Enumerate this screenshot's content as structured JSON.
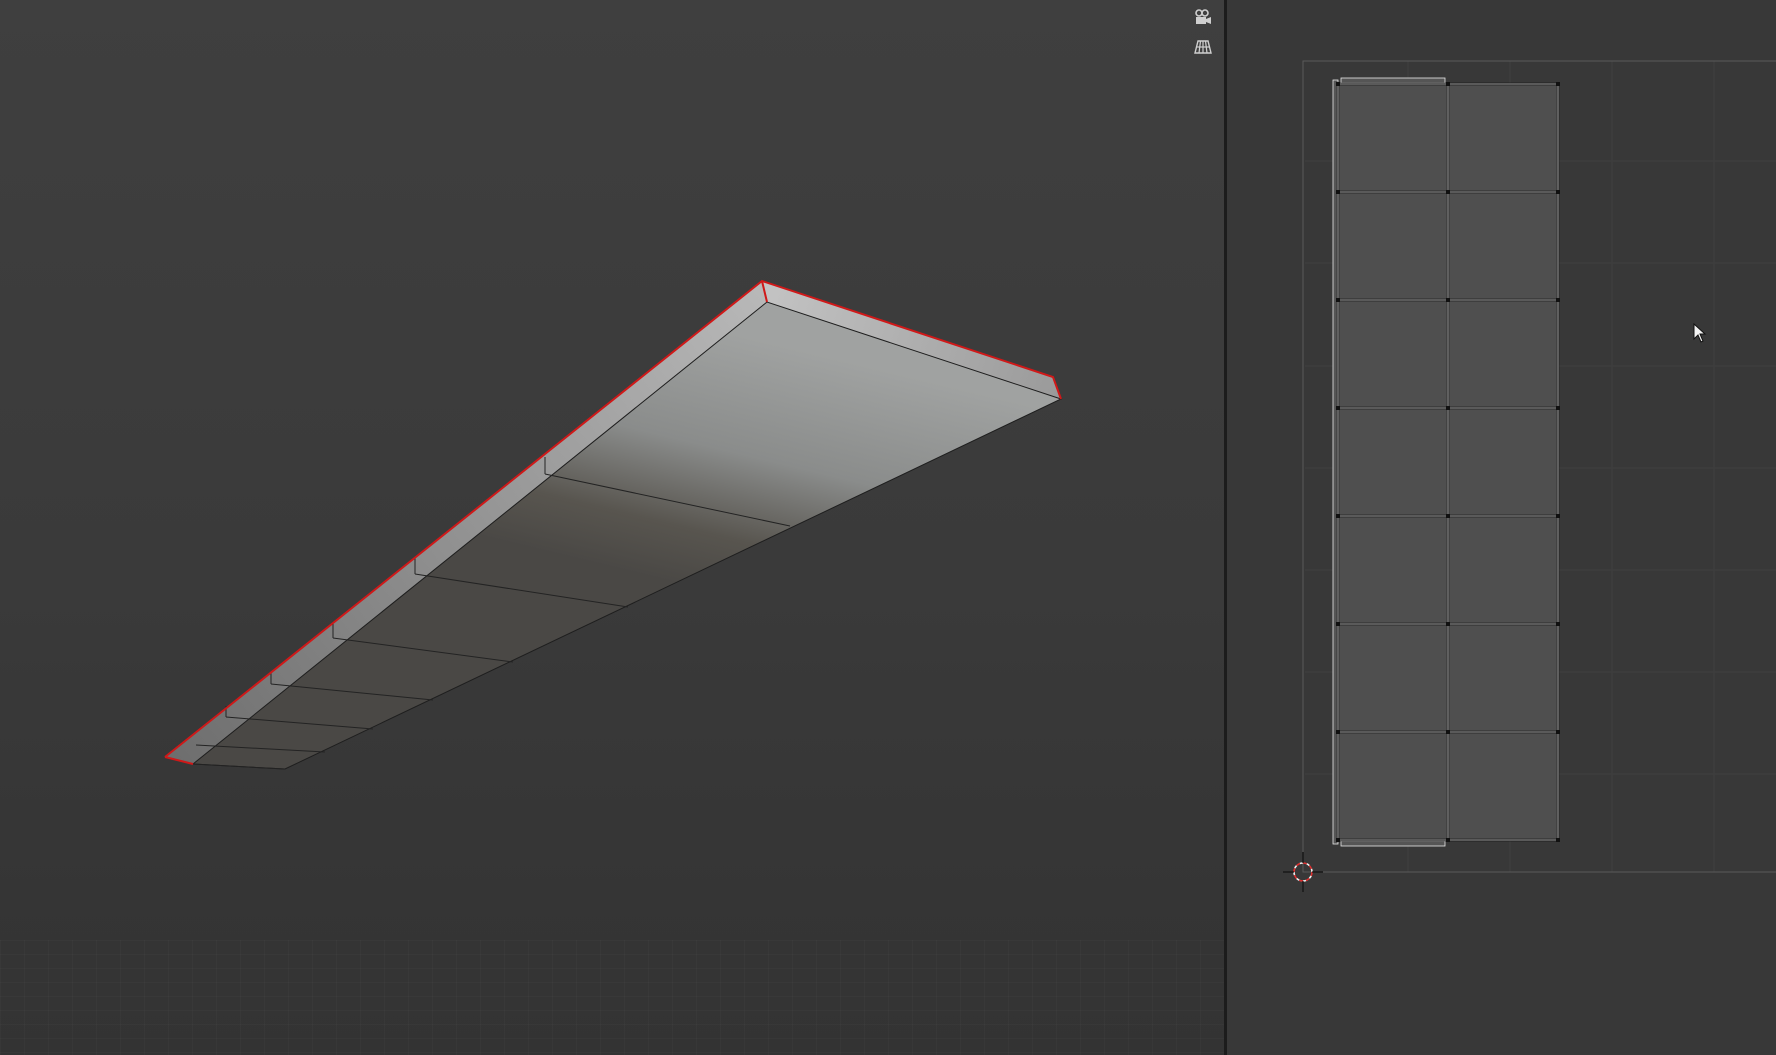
{
  "viewport": {
    "nav_icons": [
      "camera-view-icon",
      "perspective-grid-icon"
    ]
  },
  "mesh": {
    "face_color_light": "#9b9d9c",
    "face_color_dark": "#4e4b48",
    "seam_color": "#d01818"
  },
  "uv_editor": {
    "island_rows": 7,
    "island_cols": 2,
    "face_color": "#4f4f4f",
    "grid_bounds_color": "#5a5a5a",
    "cursor_color": "#e03030"
  },
  "colors": {
    "viewport_bg": "#3c3c3c",
    "uv_bg": "#383838",
    "divider": "#1c1c1c"
  }
}
